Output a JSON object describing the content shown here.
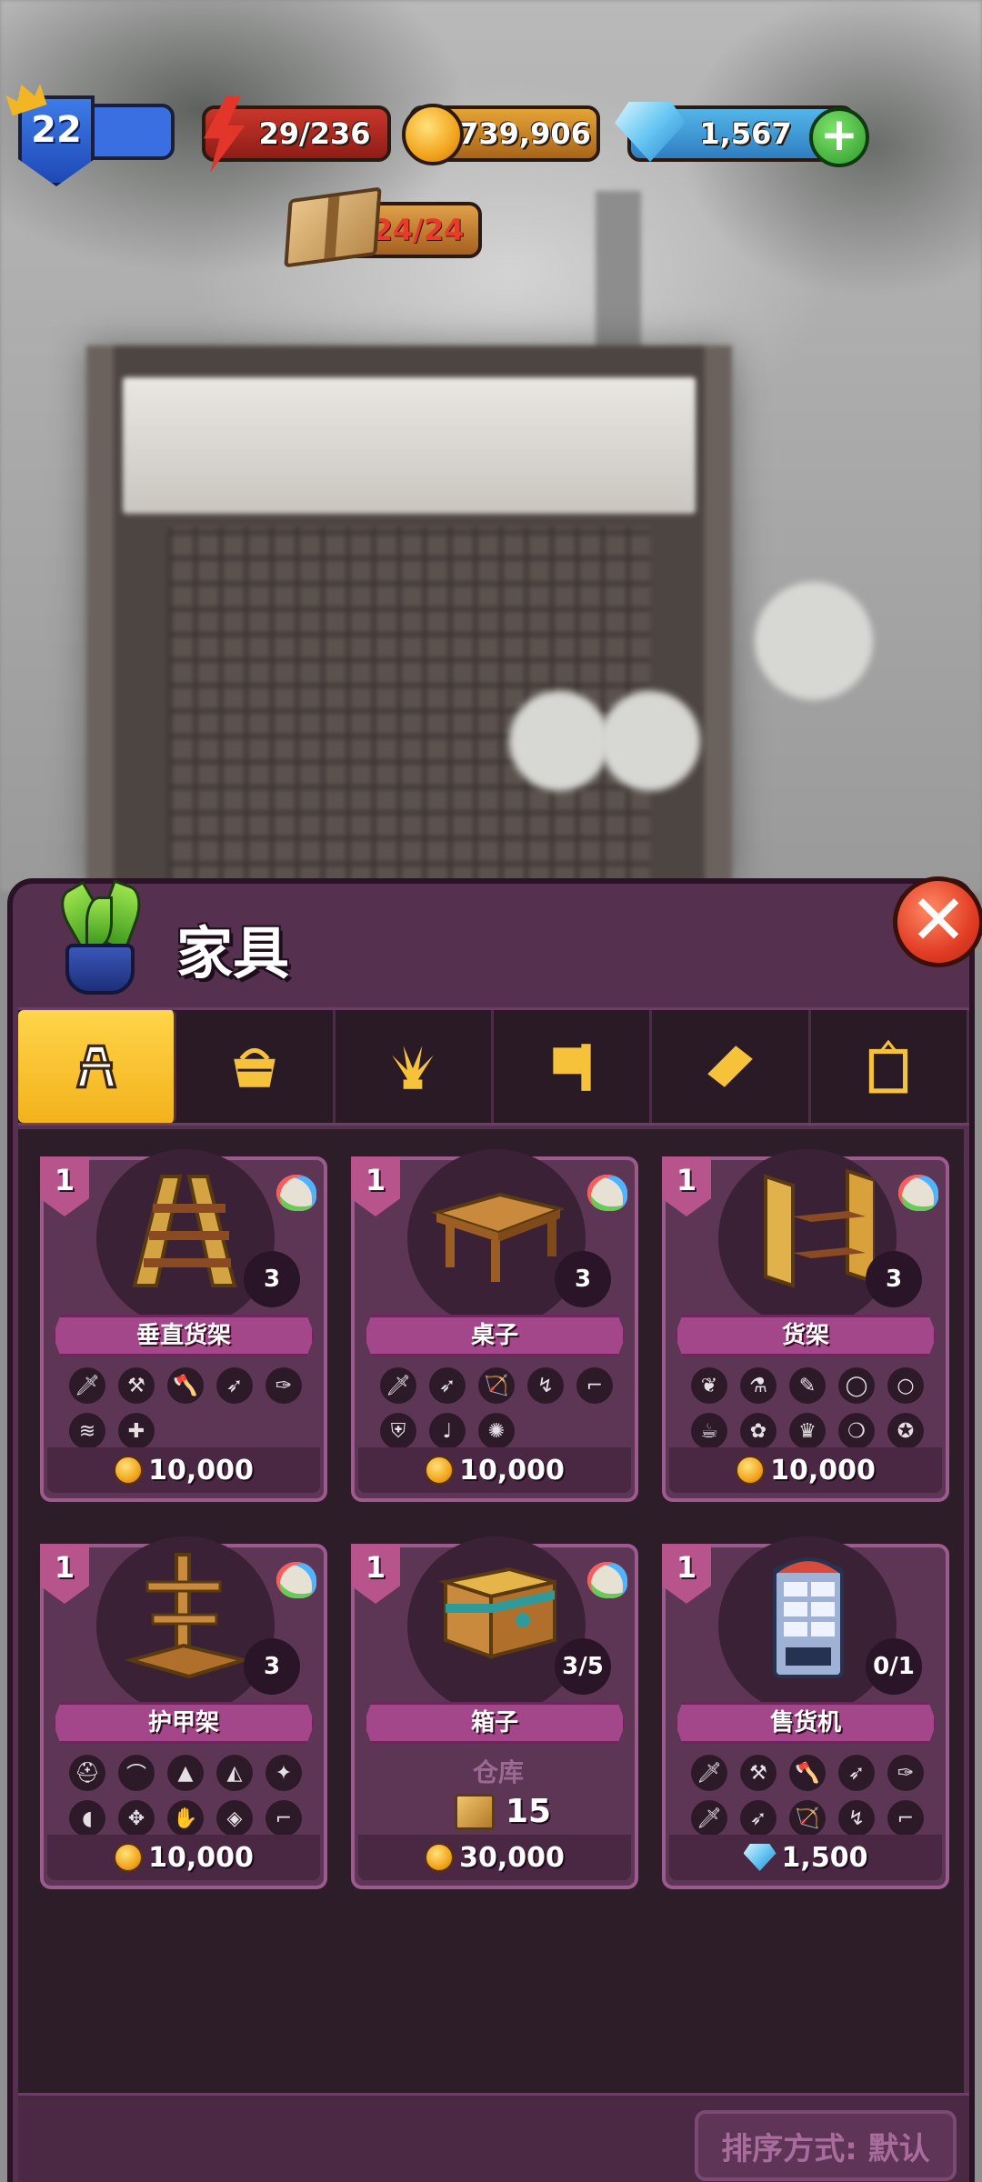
{
  "hud": {
    "level": "22",
    "energy": "29/236",
    "coins": "739,906",
    "gems": "1,567",
    "crates": "24/24"
  },
  "panel": {
    "title": "家具",
    "tabs": [
      {
        "icon": "rack-icon",
        "active": true
      },
      {
        "icon": "basket-icon",
        "active": false
      },
      {
        "icon": "plant-icon",
        "active": false
      },
      {
        "icon": "sign-icon",
        "active": false
      },
      {
        "icon": "rug-icon",
        "active": false
      },
      {
        "icon": "frame-icon",
        "active": false
      }
    ],
    "cards": [
      {
        "level": "1",
        "name": "垂直货架",
        "count": "3",
        "price": "10,000",
        "currency": "coin",
        "slots": [
          "🗡",
          "⚒",
          "🪓",
          "➶",
          "✑",
          "≋",
          "✚"
        ]
      },
      {
        "level": "1",
        "name": "桌子",
        "count": "3",
        "price": "10,000",
        "currency": "coin",
        "slots": [
          "🗡",
          "➶",
          "🏹",
          "↯",
          "⌐",
          "⛨",
          "♩",
          "✺"
        ]
      },
      {
        "level": "1",
        "name": "货架",
        "count": "3",
        "price": "10,000",
        "currency": "coin",
        "slots": [
          "❦",
          "⚗",
          "✎",
          "◯",
          "○",
          "☕",
          "✿",
          "♛",
          "❍",
          "✪"
        ]
      },
      {
        "level": "1",
        "name": "护甲架",
        "count": "3",
        "price": "10,000",
        "currency": "coin",
        "slots": [
          "⛑",
          "⌒",
          "▲",
          "◭",
          "✦",
          "◖",
          "✥",
          "✋",
          "◈",
          "⌐"
        ]
      },
      {
        "level": "1",
        "name": "箱子",
        "count": "3/5",
        "price": "30,000",
        "currency": "coin",
        "storage_label": "仓库",
        "storage_count": "15"
      },
      {
        "level": "1",
        "name": "售货机",
        "count": "0/1",
        "price": "1,500",
        "currency": "gem",
        "slots": [
          "🗡",
          "⚒",
          "🪓",
          "➶",
          "✑",
          "🗡",
          "➶",
          "🏹",
          "↯",
          "⌐"
        ]
      }
    ],
    "sort_label": "排序方式: 默认"
  }
}
